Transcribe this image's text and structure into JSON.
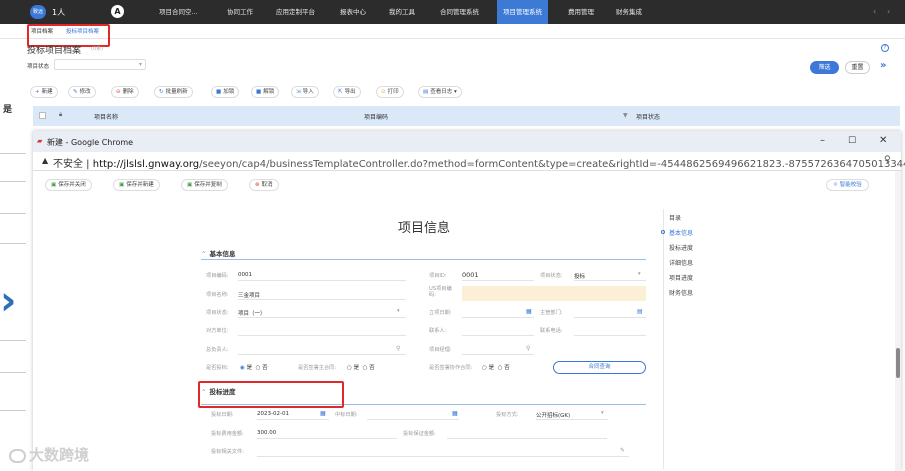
{
  "topnav": {
    "logo_text": "致远",
    "user": "1人",
    "items": [
      "项目合同空...",
      "协同工作",
      "应用定制平台",
      "报表中心",
      "我的工具",
      "合同管理系统",
      "项目管理系统",
      "费用管理",
      "财务集成"
    ],
    "active_index": 6
  },
  "tabs": [
    "项目档案",
    "投标项目档案"
  ],
  "page": {
    "title": "投标项目档案",
    "sub": "(0条)",
    "filter_label": "项目状态",
    "filter_value": "",
    "btn_filter": "筛选",
    "btn_reset": "重置"
  },
  "toolbar": [
    "新建",
    "修改",
    "删除",
    "批量刷新",
    "加锁",
    "解锁",
    "导入",
    "导出",
    "打印",
    "查看日志"
  ],
  "table": {
    "col1": "项目名称",
    "col2": "项目编码",
    "col3": "项目状态"
  },
  "left_fragment": "是",
  "chrome": {
    "title": "新建 - Google Chrome",
    "insecure": "不安全",
    "url_host": "http://jlslsl.gnway.org",
    "url_rest": "/seeyon/cap4/businessTemplateController.do?method=formContent&type=create&rightId=-4544862569496621823.-8755726364705013344&..."
  },
  "form_buttons": [
    "保存并关闭",
    "保存并新建",
    "保存并复制",
    "取消"
  ],
  "smart_check": "智能校验",
  "form": {
    "title": "项目信息",
    "section1": "基本信息",
    "section2": "投标进度",
    "fields": {
      "code_label": "项目编码:",
      "code_value": "0001",
      "id_label": "项目ID:",
      "id_value": "0001",
      "status_label": "项目状态:",
      "status_value": "投标",
      "name_label": "项目名称:",
      "name_value": "三金项目",
      "us_label": "US项目编码:",
      "state_label": "项目状态:",
      "state_value": "项目（一）",
      "start_label": "立项日期:",
      "dept_label": "主管部门:",
      "partner_label": "对方单位:",
      "contact_label": "联系人:",
      "phone_label": "联系电话:",
      "owner_label": "总负责人:",
      "manager_label": "项目经理:",
      "bid_label": "是否投标:",
      "yes": "是",
      "no": "否",
      "sign_label": "是否签署主合同:",
      "coop_label": "是否签署协作合同:",
      "contract_query": "合同查询",
      "bid_date_label": "投标日期:",
      "bid_date_value": "2023-02-01",
      "win_date_label": "中标日期:",
      "bid_method_label": "投标方式:",
      "bid_method_value": "公开招标(GK)",
      "bid_fee_label": "投标费用金额:",
      "bid_fee_value": "300.00",
      "bid_deposit_label": "投标保证金额:",
      "bid_file_label": "投标相关文件:"
    }
  },
  "toc": [
    "目录",
    "基本信息",
    "投标进度",
    "详细信息",
    "项目进度",
    "财务信息"
  ],
  "toc_active": 1,
  "watermark": "大数跨境"
}
